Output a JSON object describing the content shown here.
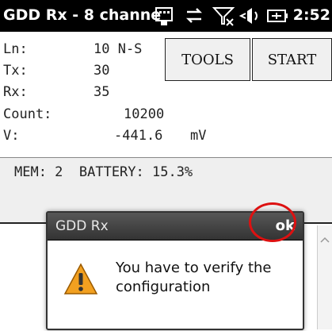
{
  "titlebar": {
    "title": "GDD Rx - 8 channe",
    "clock": "2:52",
    "icons": [
      "sip-keyboard-icon",
      "data-transfer-icon",
      "signal-off-icon",
      "volume-icon",
      "battery-charging-icon"
    ]
  },
  "fields": {
    "ln_label": "Ln:",
    "ln_value": "10 N-S",
    "tx_label": "Tx:",
    "tx_value": "30",
    "rx_label": "Rx:",
    "rx_value": "35",
    "count_label": "Count:",
    "count_value": "10200",
    "v_label": "V:",
    "v_value": "-441.6",
    "v_unit": "mV"
  },
  "buttons": {
    "tools": "TOOLS",
    "start": "START"
  },
  "status": {
    "text": "MEM: 2  BATTERY: 15.3%"
  },
  "dialog": {
    "title": "GDD Rx",
    "ok": "ok",
    "message": "You have to verify the configuration",
    "icon": "warning-icon"
  },
  "colors": {
    "highlight": "#dd1111",
    "warning": "#f2a020"
  }
}
